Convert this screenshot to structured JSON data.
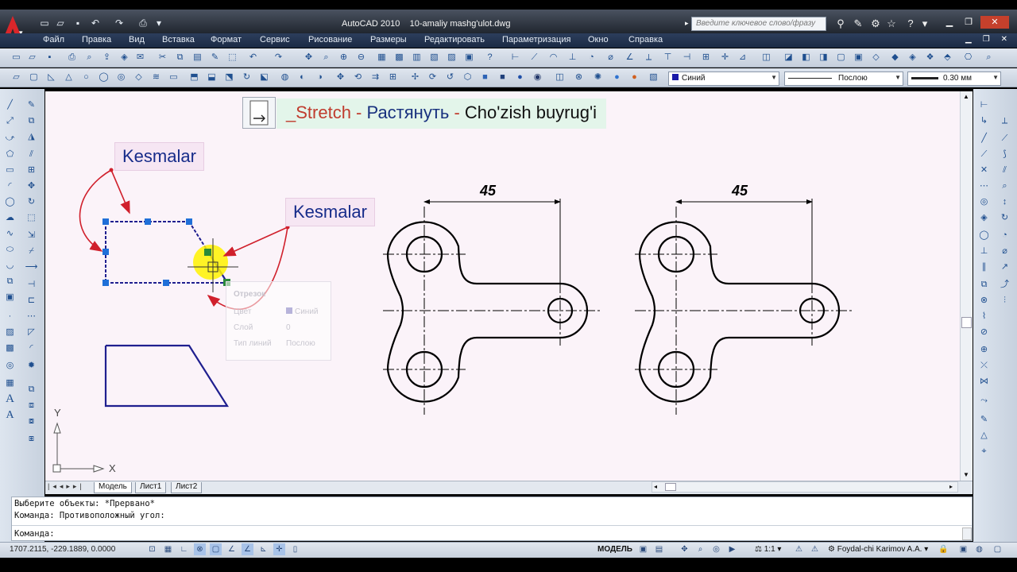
{
  "titlebar": {
    "app_name": "AutoCAD 2010",
    "file_name": "10-amaliy mashg'ulot.dwg",
    "search_placeholder": "Введите ключевое слово/фразу"
  },
  "menu": [
    "Файл",
    "Правка",
    "Вид",
    "Вставка",
    "Формат",
    "Сервис",
    "Рисование",
    "Размеры",
    "Редактировать",
    "Параметризация",
    "Окно",
    "Справка"
  ],
  "properties": {
    "color": "Синий",
    "linetype": "Послою",
    "lineweight": "0.30 мм"
  },
  "overlay": {
    "command_en": "_Stretch",
    "sep1": " - ",
    "command_ru": "Растянуть",
    "sep2": " - ",
    "command_uz": "Cho'zish buyrug'i",
    "callout1": "Kesmalar",
    "callout2": "Kesmalar"
  },
  "tooltip": {
    "title": "Отрезок",
    "rows": [
      {
        "label": "Цвет",
        "value": "Синий"
      },
      {
        "label": "Слой",
        "value": "0"
      },
      {
        "label": "Тип линий",
        "value": "Послою"
      }
    ]
  },
  "drawing": {
    "dimension_left": "45",
    "dimension_right": "45",
    "ucs_x": "X",
    "ucs_y": "Y"
  },
  "layout_tabs": [
    "Модель",
    "Лист1",
    "Лист2"
  ],
  "command_history": [
    "Выберите объекты: *Прервано*",
    "Команда: Противоположный угол:"
  ],
  "command_prompt": "Команда:",
  "status": {
    "coordinates": "1707.2115, -229.1889, 0.0000",
    "model_label": "МОДЕЛЬ",
    "scale": "1:1",
    "workspace_user": "Foydal-chi Karimov A.A."
  },
  "colors": {
    "entity_blue": "#1f1f8f",
    "callout_text": "#172c8a",
    "arrow_red": "#d0202c",
    "grip_blue": "#1f6fd8",
    "canvas_bg": "#fbf3f9"
  }
}
